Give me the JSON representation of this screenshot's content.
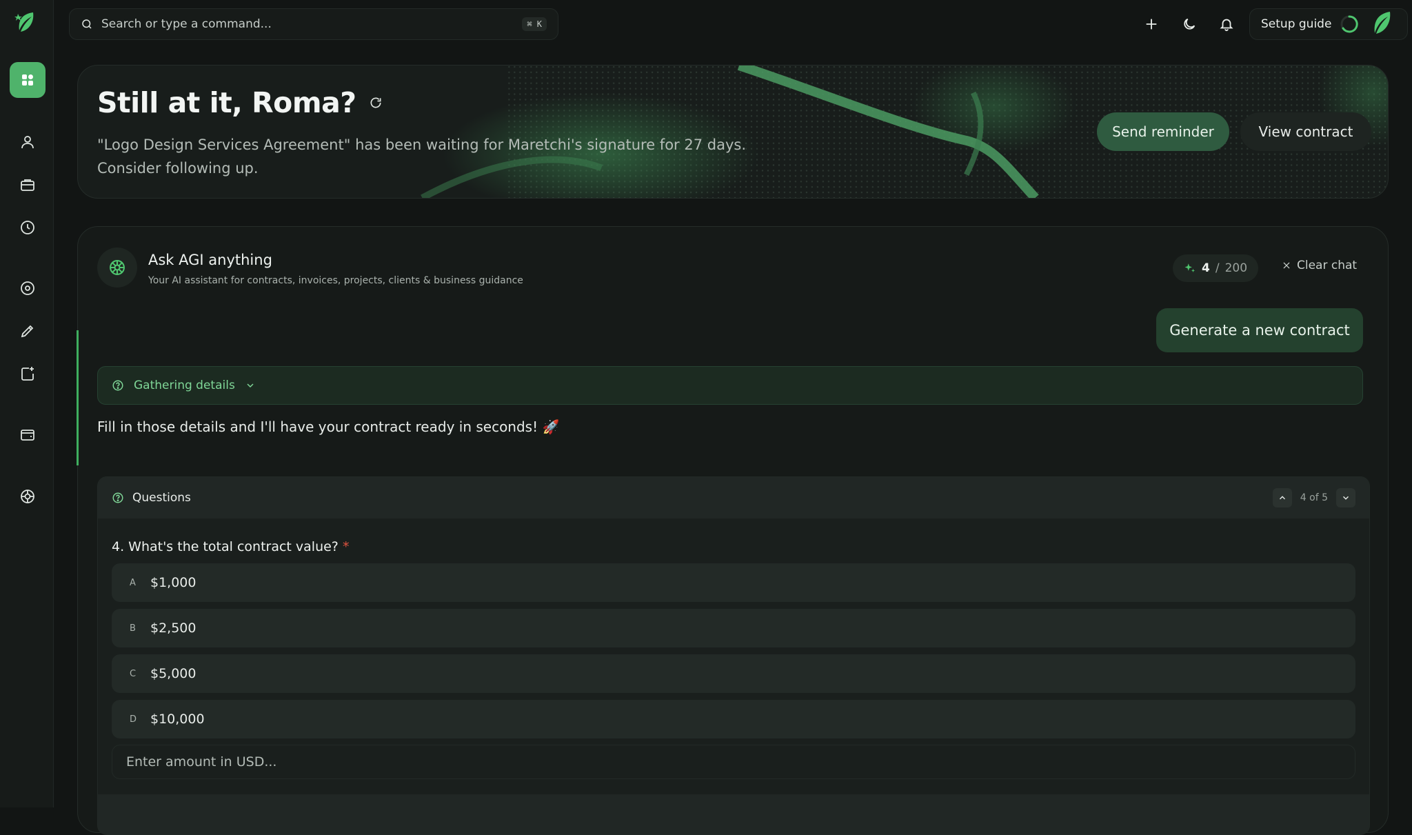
{
  "search": {
    "placeholder": "Search or type a command...",
    "shortcut": "⌘ K"
  },
  "topbar": {
    "setup_label": "Setup guide"
  },
  "hero": {
    "title": "Still at it, Roma?",
    "subtitle": "\"Logo Design Services Agreement\" has been waiting for Maretchi's signature for 27 days. Consider following up.",
    "send_label": "Send reminder",
    "view_label": "View contract"
  },
  "chat": {
    "title": "Ask AGI anything",
    "subtitle": "Your AI assistant for contracts, invoices, projects, clients & business guidance",
    "credits_used": "4",
    "credits_sep": "/",
    "credits_total": "200",
    "clear_label": "Clear chat",
    "user_message": "Generate a new contract",
    "gathering_label": "Gathering details",
    "ai_message": "Fill in those details and I'll have your contract ready in seconds! 🚀"
  },
  "questions": {
    "header": "Questions",
    "counter": "4 of 5",
    "question": "4. What's the total contract value?",
    "required_mark": "*",
    "options": [
      {
        "letter": "A",
        "value": "$1,000"
      },
      {
        "letter": "B",
        "value": "$2,500"
      },
      {
        "letter": "C",
        "value": "$5,000"
      },
      {
        "letter": "D",
        "value": "$10,000"
      }
    ],
    "amount_placeholder": "Enter amount in USD..."
  },
  "colors": {
    "accent": "#4fb36b",
    "background": "#121514",
    "panel": "#161a18",
    "required": "#e0533f"
  }
}
